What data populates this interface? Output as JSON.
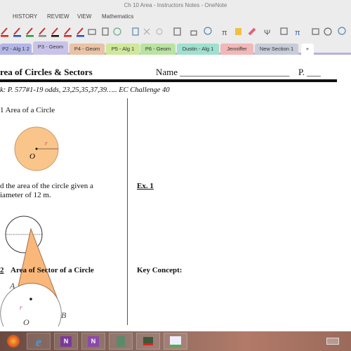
{
  "window": {
    "title": "Ch 10  Area - Instructors Notes - OneNote"
  },
  "menu": {
    "items": [
      "HISTORY",
      "REVIEW",
      "VIEW",
      "Mathematics"
    ]
  },
  "toolbar": {
    "pens": [
      "#e02020",
      "#2050c0",
      "#20a040",
      "#888888",
      "#111111",
      "#e02020",
      "#2050c0"
    ],
    "icons": [
      "print-icon",
      "print-preview-icon",
      "circle-icon",
      "insert-icon",
      "close-icon",
      "circle-icon",
      "border-icon",
      "image-icon",
      "shapes-icon",
      "pi-icon",
      "highlight-icon",
      "eraser-icon",
      "psi-icon",
      "grid-icon",
      "pi-icon",
      "table-icon",
      "bubble-icon",
      "shapes-icon"
    ],
    "pi": "π",
    "psi": "Ψ"
  },
  "tabs": [
    {
      "label": "P2 - Alg 1 2",
      "color": "#b3b6e6"
    },
    {
      "label": "P3 - Geom",
      "color": "#c9c3ea",
      "active": true
    },
    {
      "label": "P4 - Geom",
      "color": "#e8c3a6"
    },
    {
      "label": "P5 - Alg 1",
      "color": "#cfe89a"
    },
    {
      "label": "P6 - Geom",
      "color": "#b9e3a1"
    },
    {
      "label": "Dustin - Alg 1",
      "color": "#9fe0cf"
    },
    {
      "label": "Jenniffer",
      "color": "#f2b8b8"
    },
    {
      "label": "New Section 1",
      "color": "#c8ccd8"
    },
    {
      "label": "+",
      "color": "#ffffff"
    }
  ],
  "page": {
    "title": "rea of Circles & Sectors",
    "name_label": "Name ________________________",
    "period_label": "P.  ___",
    "homework": "k:  P. 577#1-19 odds, 23,25,35,37,39….. EC Challenge 40",
    "section1": "1  Area of a Circle",
    "circle_labels": {
      "radius": "r",
      "center": "O"
    },
    "problem_line1": "d the area of the circle given a",
    "problem_line2": "iameter of 12 m.",
    "example": "Ex. 1",
    "section2_num": "2",
    "section2": "Area of Sector of a Circle",
    "key_concept": "Key Concept:",
    "sector_labels": {
      "a": "A",
      "b": "B",
      "center": "O",
      "radius": "r"
    },
    "circle_fill": "#f9c58a"
  },
  "taskbar": {
    "apps": [
      "firefox",
      "internet-explorer",
      "onenote",
      "onenote-clipper",
      "app",
      "app-red",
      "app-green"
    ]
  }
}
